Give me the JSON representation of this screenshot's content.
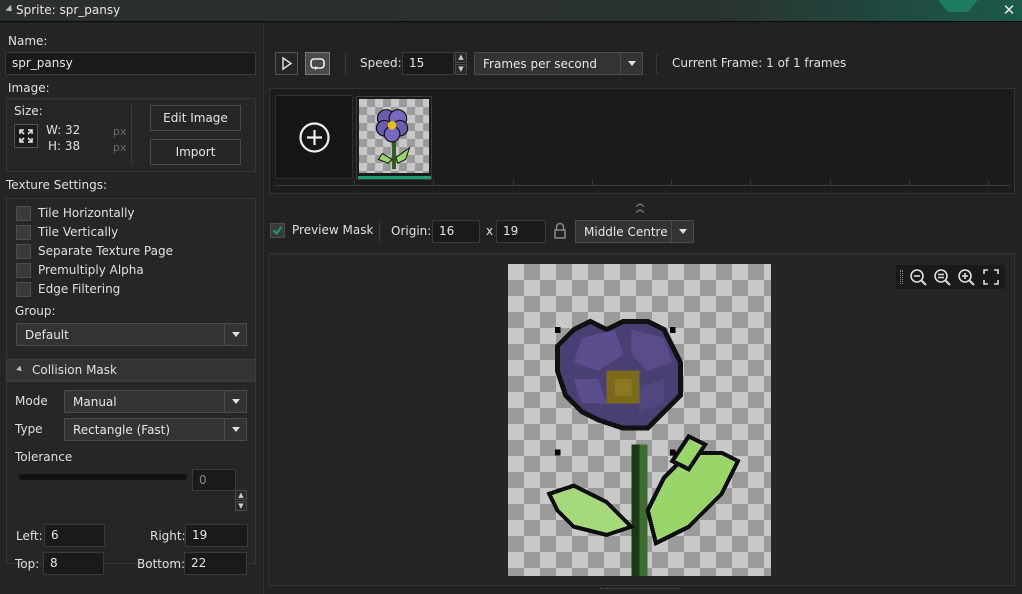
{
  "window": {
    "title": "Sprite: spr_pansy"
  },
  "left": {
    "name_label": "Name:",
    "name_value": "spr_pansy",
    "image_label": "Image:",
    "size_label": "Size:",
    "width_text": "W: 32",
    "height_text": "H: 38",
    "px_unit": "px",
    "edit_image_button": "Edit Image",
    "import_button": "Import",
    "texture_settings_label": "Texture Settings:",
    "checkboxes": [
      {
        "label": "Tile Horizontally",
        "checked": false
      },
      {
        "label": "Tile Vertically",
        "checked": false
      },
      {
        "label": "Separate Texture Page",
        "checked": false
      },
      {
        "label": "Premultiply Alpha",
        "checked": false
      },
      {
        "label": "Edge Filtering",
        "checked": false
      }
    ],
    "group_label": "Group:",
    "group_value": "Default",
    "collision": {
      "header": "Collision Mask",
      "mode_label": "Mode",
      "mode_value": "Manual",
      "type_label": "Type",
      "type_value": "Rectangle (Fast)",
      "tolerance_label": "Tolerance",
      "tolerance_value": "0",
      "left_label": "Left:",
      "left_value": "6",
      "right_label": "Right:",
      "right_value": "19",
      "top_label": "Top:",
      "top_value": "8",
      "bottom_label": "Bottom:",
      "bottom_value": "22"
    }
  },
  "toolbar": {
    "speed_label": "Speed:",
    "speed_value": "15",
    "speed_unit": "Frames per second",
    "current_frame": "Current Frame: 1 of 1 frames"
  },
  "preview": {
    "preview_mask_label": "Preview Mask",
    "preview_mask_checked": true,
    "origin_label": "Origin:",
    "origin_x": "16",
    "origin_sep": "x",
    "origin_y": "19",
    "origin_preset": "Middle Centre"
  },
  "colors": {
    "accent": "#1e9e73",
    "check": "#1e9e73"
  }
}
